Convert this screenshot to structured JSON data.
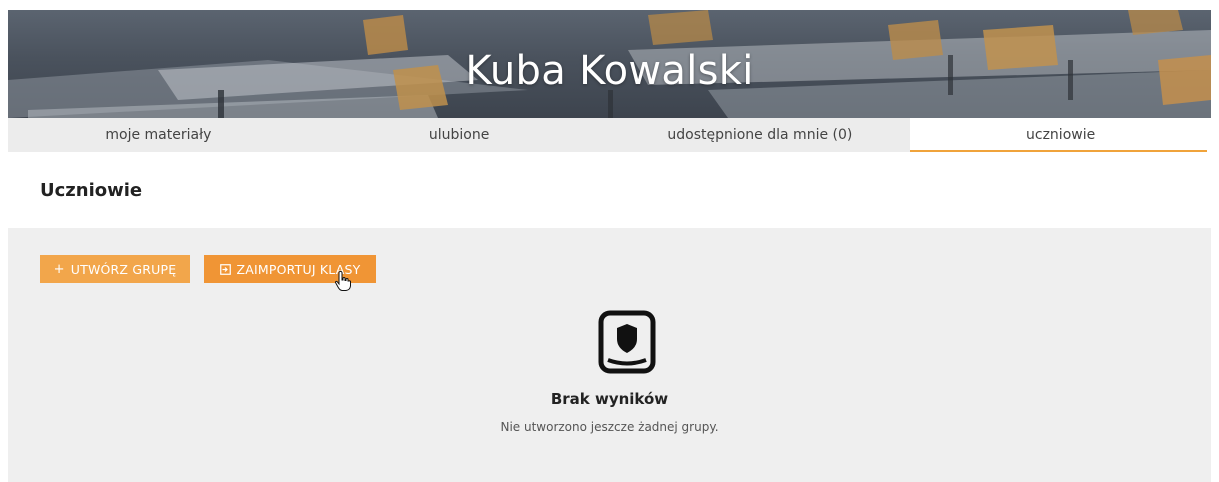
{
  "header": {
    "title": "Kuba Kowalski"
  },
  "tabs": [
    {
      "label": "moje materiały",
      "active": false
    },
    {
      "label": "ulubione",
      "active": false
    },
    {
      "label": "udostępnione dla mnie (0)",
      "active": false
    },
    {
      "label": "uczniowie",
      "active": true
    }
  ],
  "section": {
    "title": "Uczniowie"
  },
  "toolbar": {
    "create_group_icon": "+",
    "create_group_label": "UTWÓRZ GRUPĘ",
    "import_classes_icon": "import-icon",
    "import_classes_label": "ZAIMPORTUJ KLASY"
  },
  "empty_state": {
    "icon": "shield-book-icon",
    "title": "Brak wyników",
    "subtitle": "Nie utworzono jeszcze żadnej grupy."
  },
  "colors": {
    "accent": "#f0a33b",
    "button_create": "#f2a64b",
    "button_import": "#f09535",
    "panel_bg": "#efefef"
  }
}
